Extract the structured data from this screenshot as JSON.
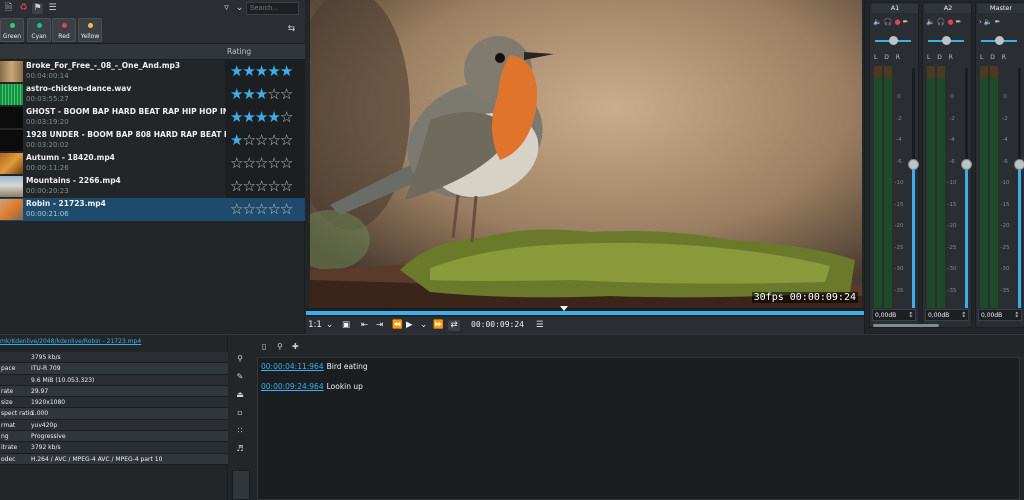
{
  "bin": {
    "search_placeholder": "Search...",
    "tags": [
      {
        "label": "Green",
        "color": "#2ecc71"
      },
      {
        "label": "Cyan",
        "color": "#1abc9c"
      },
      {
        "label": "Red",
        "color": "#da4453"
      },
      {
        "label": "Yellow",
        "color": "#fdbc4b"
      }
    ],
    "rating_header": "Rating",
    "clips": [
      {
        "name": "Broke_For_Free_-_08_-_One_And.mp3",
        "duration": "00:04:00:14",
        "rating": 5,
        "thumb": "audio-waveform-beige"
      },
      {
        "name": "astro-chicken-dance.wav",
        "duration": "00:03:55:27",
        "rating": 3,
        "thumb": "audio-waveform-green"
      },
      {
        "name": "GHOST - BOOM BAP HARD BEAT RAP HIP HOP INSTRUMENT",
        "duration": "00:03:19:20",
        "rating": 4,
        "thumb": "audio-black"
      },
      {
        "name": "1928 UNDER - BOOM BAP 808 HARD RAP BEAT HIP HOP INS",
        "duration": "00:03:20:02",
        "rating": 1,
        "thumb": "audio-black"
      },
      {
        "name": "Autumn - 18420.mp4",
        "duration": "00:00:11:26",
        "rating": 0,
        "thumb": "autumn"
      },
      {
        "name": "Mountains - 2266.mp4",
        "duration": "00:00:20:23",
        "rating": 0,
        "thumb": "mountains"
      },
      {
        "name": "Robin - 21723.mp4",
        "duration": "00:00:21:06",
        "rating": 0,
        "thumb": "robin",
        "selected": true
      }
    ]
  },
  "monitor": {
    "overlay_timecode": "30fps 00:00:09:24",
    "zoom": "1:1",
    "timecode": "00:00:09:24"
  },
  "mixer": {
    "channels": [
      {
        "name": "A1",
        "gain": "0,00dB"
      },
      {
        "name": "A2",
        "gain": "0,00dB"
      },
      {
        "name": "Master",
        "gain": "0,00dB"
      }
    ],
    "lr_label": "L D R",
    "db_marks": [
      "0",
      "-2",
      "-4",
      "-6",
      "-10",
      "-15",
      "-20",
      "-25",
      "-30",
      "-35",
      "-45"
    ]
  },
  "clip_info": {
    "path": "mk/Kdenlive/2048/kdenlive/Robin - 21723.mp4",
    "rows": [
      {
        "key": "",
        "value": "3795 kb/s"
      },
      {
        "key": "pace",
        "value": "ITU-R 709"
      },
      {
        "key": "",
        "value": "9.6 MiB (10.053.323)"
      },
      {
        "key": "rate",
        "value": "29.97"
      },
      {
        "key": "size",
        "value": "1920x1080"
      },
      {
        "key": "spect ratio",
        "value": "1.000"
      },
      {
        "key": "rmat",
        "value": "yuv420p"
      },
      {
        "key": "ng",
        "value": "Progressive"
      },
      {
        "key": "itrate",
        "value": "3792 kb/s"
      },
      {
        "key": "odec",
        "value": "H.264 / AVC / MPEG-4 AVC / MPEG-4 part 10"
      }
    ]
  },
  "markers": [
    {
      "timecode": "00:00:04:11:964",
      "label": "Bird eating"
    },
    {
      "timecode": "00:00:09:24:964",
      "label": "Lookin up"
    }
  ]
}
